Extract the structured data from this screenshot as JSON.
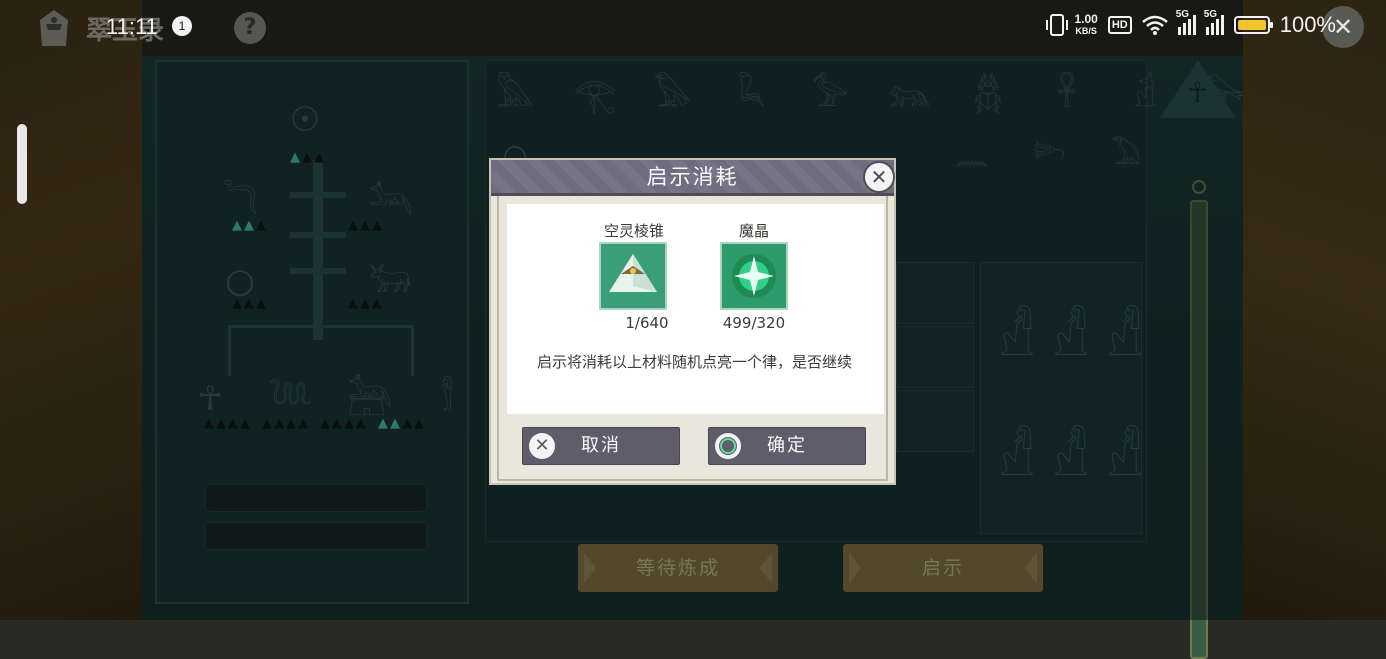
{
  "status_bar": {
    "time": "11:11",
    "notification_count": "1",
    "net_speed_value": "1.00",
    "net_speed_unit": "KB/S",
    "hd_label": "HD",
    "signal1_label": "5G",
    "signal2_label": "5G",
    "battery_percent": "100%",
    "battery_level": 1.0
  },
  "header": {
    "game_title": "翠玉录",
    "help_glyph": "?",
    "close_glyph": "✕"
  },
  "board": {
    "bottom_buttons": [
      "等待炼成",
      "启示"
    ]
  },
  "dialog": {
    "title": "启示消耗",
    "close_glyph": "✕",
    "materials": [
      {
        "name": "空灵棱锥",
        "count": "1/640",
        "icon": "pyramid-icon"
      },
      {
        "name": "魔晶",
        "count": "499/320",
        "icon": "magic-crystal-icon"
      }
    ],
    "message": "启示将消耗以上材料随机点亮一个律，是否继续",
    "cancel_label": "取消",
    "confirm_label": "确定"
  }
}
